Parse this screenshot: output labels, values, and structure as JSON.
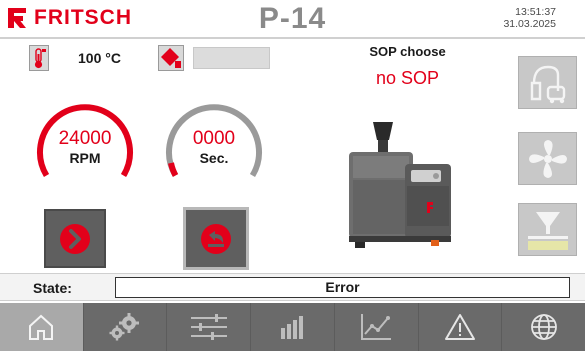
{
  "header": {
    "brand": "FRITSCH",
    "machine": "P-14",
    "time": "13:51:37",
    "date": "31.03.2025"
  },
  "temperature": {
    "value": "100 °C",
    "icon": "thermometer-icon"
  },
  "warning": {
    "icon": "warning-diamond-icon",
    "status_text": ""
  },
  "gauges": {
    "speed": {
      "value": "24000",
      "unit": "RPM",
      "color": "#e2001a"
    },
    "time": {
      "value": "0000",
      "unit": "Sec.",
      "color": "#9a9a9a"
    }
  },
  "actions": {
    "start": {
      "icon": "play-circle-icon"
    },
    "program": {
      "icon": "return-arrow-icon"
    }
  },
  "sop": {
    "label": "SOP choose",
    "value": "no SOP"
  },
  "side_buttons": [
    {
      "icon": "vacuum-cleaner-icon"
    },
    {
      "icon": "fan-icon"
    },
    {
      "icon": "funnel-sieve-icon"
    }
  ],
  "state": {
    "label": "State:",
    "value": "Error"
  },
  "nav": [
    {
      "icon": "home-icon",
      "active": true
    },
    {
      "icon": "settings-gears-icon",
      "active": false
    },
    {
      "icon": "sliders-icon",
      "active": false
    },
    {
      "icon": "bar-chart-icon",
      "active": false
    },
    {
      "icon": "line-chart-icon",
      "active": false
    },
    {
      "icon": "alert-triangle-icon",
      "active": false
    },
    {
      "icon": "globe-icon",
      "active": false
    }
  ],
  "colors": {
    "brand_red": "#e2001a",
    "nav_bg": "#6a6a6a",
    "nav_active": "#a9a9a9",
    "side_button_bg": "#c8c8c8"
  }
}
